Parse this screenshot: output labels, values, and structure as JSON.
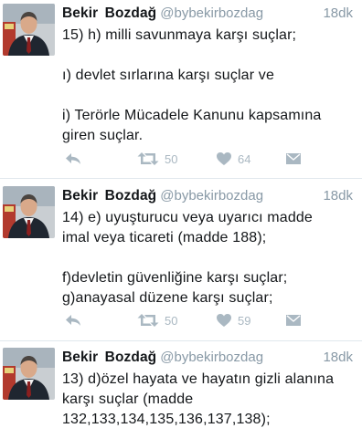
{
  "tweets": [
    {
      "name": "Bekir  Bozdağ",
      "handle": "@bybekirbozdag",
      "time": "18dk",
      "text": "15) h) milli savunmaya karşı suçlar;\n\nı) devlet sırlarına karşı suçlar ve\n\ni) Terörle Mücadele Kanunu kapsamına\ngiren suçlar.",
      "retweets": "50",
      "likes": "64",
      "icons": [
        "reply-icon",
        "retweet-icon",
        "heart-icon",
        "dm-icon"
      ]
    },
    {
      "name": "Bekir  Bozdağ",
      "handle": "@bybekirbozdag",
      "time": "18dk",
      "text": "14) e) uyuşturucu veya uyarıcı madde\nimal veya ticareti (madde 188);\n\nf)devletin güvenliğine karşı suçlar;\ng)anayasal düzene karşı suçlar;",
      "retweets": "50",
      "likes": "59",
      "icons": [
        "reply-icon",
        "retweet-icon",
        "heart-icon",
        "dm-icon"
      ]
    },
    {
      "name": "Bekir  Bozdağ",
      "handle": "@bybekirbozdag",
      "time": "18dk",
      "text": "13) d)özel hayata ve hayatın gizli alanına\nkarşı suçlar (madde\n132,133,134,135,136,137,138);",
      "icons": []
    }
  ],
  "colors": {
    "text": "#14171a",
    "secondary": "#8899a6",
    "icon": "#aab8c2",
    "divider": "#e1e8ed"
  }
}
